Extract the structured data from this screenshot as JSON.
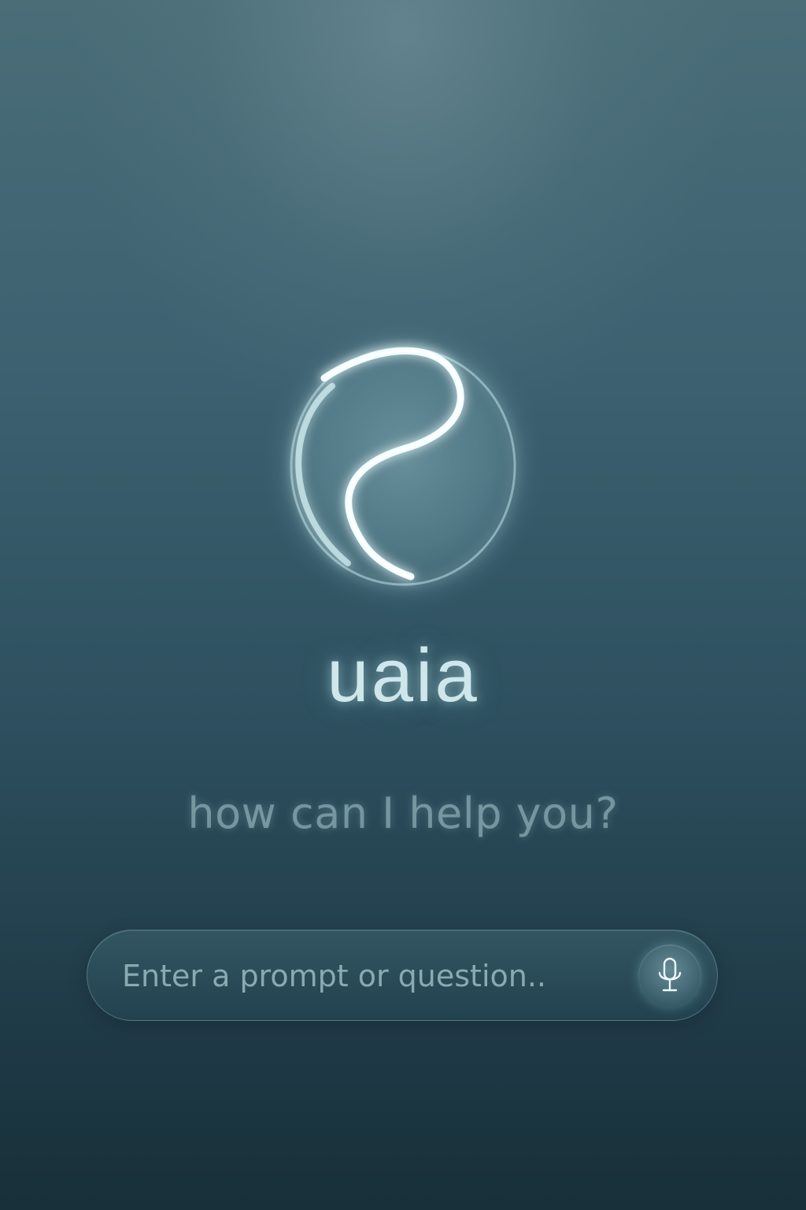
{
  "app": {
    "name": "uaia",
    "greeting": "how can I help you?"
  },
  "logo": {
    "icon": "swirl-orb-logo-icon"
  },
  "prompt": {
    "placeholder": "Enter a prompt or question..",
    "value": "",
    "mic_icon": "microphone-icon"
  },
  "colors": {
    "background_top": "#4a6d78",
    "background_bottom": "#173039",
    "brand_text": "#cfe7ea",
    "accent_glow": "#bfeef2"
  }
}
